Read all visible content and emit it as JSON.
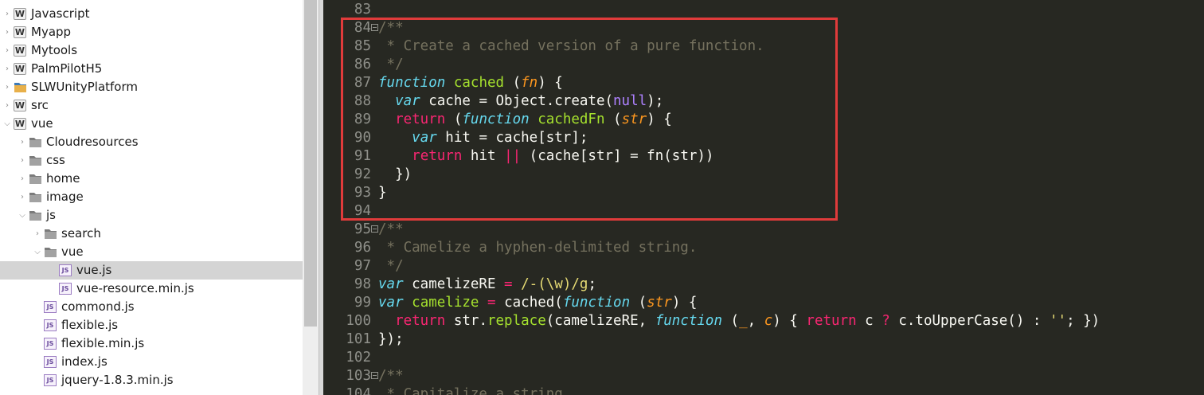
{
  "explorer": {
    "items": [
      {
        "label": "Javascript",
        "kind": "project",
        "depth": 0,
        "chevron": "collapsed"
      },
      {
        "label": "Myapp",
        "kind": "project",
        "depth": 0,
        "chevron": "collapsed"
      },
      {
        "label": "Mytools",
        "kind": "project",
        "depth": 0,
        "chevron": "collapsed"
      },
      {
        "label": "PalmPilotH5",
        "kind": "project",
        "depth": 0,
        "chevron": "collapsed"
      },
      {
        "label": "SLWUnityPlatform",
        "kind": "special-folder",
        "depth": 0,
        "chevron": "collapsed"
      },
      {
        "label": "src",
        "kind": "project",
        "depth": 0,
        "chevron": "collapsed"
      },
      {
        "label": "vue",
        "kind": "project",
        "depth": 0,
        "chevron": "expanded"
      },
      {
        "label": "Cloudresources",
        "kind": "folder",
        "depth": 1,
        "chevron": "collapsed"
      },
      {
        "label": "css",
        "kind": "folder",
        "depth": 1,
        "chevron": "collapsed"
      },
      {
        "label": "home",
        "kind": "folder",
        "depth": 1,
        "chevron": "collapsed"
      },
      {
        "label": "image",
        "kind": "folder",
        "depth": 1,
        "chevron": "collapsed"
      },
      {
        "label": "js",
        "kind": "folder",
        "depth": 1,
        "chevron": "expanded"
      },
      {
        "label": "search",
        "kind": "folder",
        "depth": 2,
        "chevron": "collapsed"
      },
      {
        "label": "vue",
        "kind": "folder",
        "depth": 2,
        "chevron": "expanded"
      },
      {
        "label": "vue.js",
        "kind": "js-file",
        "depth": 3,
        "chevron": "none",
        "selected": true
      },
      {
        "label": "vue-resource.min.js",
        "kind": "js-file",
        "depth": 3,
        "chevron": "none"
      },
      {
        "label": "commond.js",
        "kind": "js-file",
        "depth": 2,
        "chevron": "none"
      },
      {
        "label": "flexible.js",
        "kind": "js-file",
        "depth": 2,
        "chevron": "none"
      },
      {
        "label": "flexible.min.js",
        "kind": "js-file",
        "depth": 2,
        "chevron": "none"
      },
      {
        "label": "index.js",
        "kind": "js-file",
        "depth": 2,
        "chevron": "none"
      },
      {
        "label": "jquery-1.8.3.min.js",
        "kind": "js-file",
        "depth": 2,
        "chevron": "none"
      }
    ]
  },
  "editor": {
    "lines": [
      {
        "num": "83",
        "fold": false,
        "tokens": []
      },
      {
        "num": "84",
        "fold": true,
        "tokens": [
          {
            "t": "/**",
            "c": "comment"
          }
        ]
      },
      {
        "num": "85",
        "fold": false,
        "tokens": [
          {
            "t": " * Create a cached version of a pure function.",
            "c": "comment"
          }
        ]
      },
      {
        "num": "86",
        "fold": false,
        "tokens": [
          {
            "t": " */",
            "c": "comment"
          }
        ]
      },
      {
        "num": "87",
        "fold": false,
        "tokens": [
          {
            "t": "function",
            "c": "storage"
          },
          {
            "t": " ",
            "c": "plain"
          },
          {
            "t": "cached",
            "c": "fname"
          },
          {
            "t": " (",
            "c": "plain"
          },
          {
            "t": "fn",
            "c": "param"
          },
          {
            "t": ") {",
            "c": "plain"
          }
        ]
      },
      {
        "num": "88",
        "fold": false,
        "tokens": [
          {
            "t": "  ",
            "c": "plain"
          },
          {
            "t": "var",
            "c": "storage"
          },
          {
            "t": " cache = Object.create(",
            "c": "plain"
          },
          {
            "t": "null",
            "c": "const"
          },
          {
            "t": ");",
            "c": "plain"
          }
        ]
      },
      {
        "num": "89",
        "fold": false,
        "tokens": [
          {
            "t": "  ",
            "c": "plain"
          },
          {
            "t": "return",
            "c": "keyword"
          },
          {
            "t": " (",
            "c": "plain"
          },
          {
            "t": "function",
            "c": "storage"
          },
          {
            "t": " ",
            "c": "plain"
          },
          {
            "t": "cachedFn",
            "c": "fname"
          },
          {
            "t": " (",
            "c": "plain"
          },
          {
            "t": "str",
            "c": "param"
          },
          {
            "t": ") {",
            "c": "plain"
          }
        ]
      },
      {
        "num": "90",
        "fold": false,
        "tokens": [
          {
            "t": "    ",
            "c": "plain"
          },
          {
            "t": "var",
            "c": "storage"
          },
          {
            "t": " hit = cache[str];",
            "c": "plain"
          }
        ]
      },
      {
        "num": "91",
        "fold": false,
        "tokens": [
          {
            "t": "    ",
            "c": "plain"
          },
          {
            "t": "return",
            "c": "keyword"
          },
          {
            "t": " hit ",
            "c": "plain"
          },
          {
            "t": "||",
            "c": "keyword"
          },
          {
            "t": " (cache[str] = fn(str))",
            "c": "plain"
          }
        ]
      },
      {
        "num": "92",
        "fold": false,
        "tokens": [
          {
            "t": "  })",
            "c": "plain"
          }
        ]
      },
      {
        "num": "93",
        "fold": false,
        "tokens": [
          {
            "t": "}",
            "c": "plain"
          }
        ]
      },
      {
        "num": "94",
        "fold": false,
        "tokens": []
      },
      {
        "num": "95",
        "fold": true,
        "tokens": [
          {
            "t": "/**",
            "c": "comment"
          }
        ]
      },
      {
        "num": "96",
        "fold": false,
        "tokens": [
          {
            "t": " * Camelize a hyphen-delimited string.",
            "c": "comment"
          }
        ]
      },
      {
        "num": "97",
        "fold": false,
        "tokens": [
          {
            "t": " */",
            "c": "comment"
          }
        ]
      },
      {
        "num": "98",
        "fold": false,
        "tokens": [
          {
            "t": "var",
            "c": "storage"
          },
          {
            "t": " camelizeRE ",
            "c": "plain"
          },
          {
            "t": "=",
            "c": "keyword"
          },
          {
            "t": " ",
            "c": "plain"
          },
          {
            "t": "/-(\\w)/g",
            "c": "string"
          },
          {
            "t": ";",
            "c": "plain"
          }
        ]
      },
      {
        "num": "99",
        "fold": false,
        "tokens": [
          {
            "t": "var",
            "c": "storage"
          },
          {
            "t": " ",
            "c": "plain"
          },
          {
            "t": "camelize",
            "c": "fname"
          },
          {
            "t": " ",
            "c": "plain"
          },
          {
            "t": "=",
            "c": "keyword"
          },
          {
            "t": " cached(",
            "c": "plain"
          },
          {
            "t": "function",
            "c": "storage"
          },
          {
            "t": " (",
            "c": "plain"
          },
          {
            "t": "str",
            "c": "param"
          },
          {
            "t": ") {",
            "c": "plain"
          }
        ]
      },
      {
        "num": "100",
        "fold": false,
        "tokens": [
          {
            "t": "  ",
            "c": "plain"
          },
          {
            "t": "return",
            "c": "keyword"
          },
          {
            "t": " str.",
            "c": "plain"
          },
          {
            "t": "replace",
            "c": "fname"
          },
          {
            "t": "(camelizeRE, ",
            "c": "plain"
          },
          {
            "t": "function",
            "c": "storage"
          },
          {
            "t": " (",
            "c": "plain"
          },
          {
            "t": "_",
            "c": "param"
          },
          {
            "t": ", ",
            "c": "plain"
          },
          {
            "t": "c",
            "c": "param"
          },
          {
            "t": ") { ",
            "c": "plain"
          },
          {
            "t": "return",
            "c": "keyword"
          },
          {
            "t": " c ",
            "c": "plain"
          },
          {
            "t": "?",
            "c": "keyword"
          },
          {
            "t": " c.toUpperCase() : ",
            "c": "plain"
          },
          {
            "t": "''",
            "c": "string"
          },
          {
            "t": "; })",
            "c": "plain"
          }
        ]
      },
      {
        "num": "101",
        "fold": false,
        "tokens": [
          {
            "t": "});",
            "c": "plain"
          }
        ]
      },
      {
        "num": "102",
        "fold": false,
        "tokens": []
      },
      {
        "num": "103",
        "fold": true,
        "tokens": [
          {
            "t": "/**",
            "c": "comment"
          }
        ]
      },
      {
        "num": "104",
        "fold": false,
        "tokens": [
          {
            "t": " * Capitalize a string.",
            "c": "comment"
          }
        ]
      }
    ]
  },
  "colors": {
    "editor_bg": "#272822",
    "highlight_border": "#e03b3b",
    "selection_row": "#d4d4d4"
  }
}
